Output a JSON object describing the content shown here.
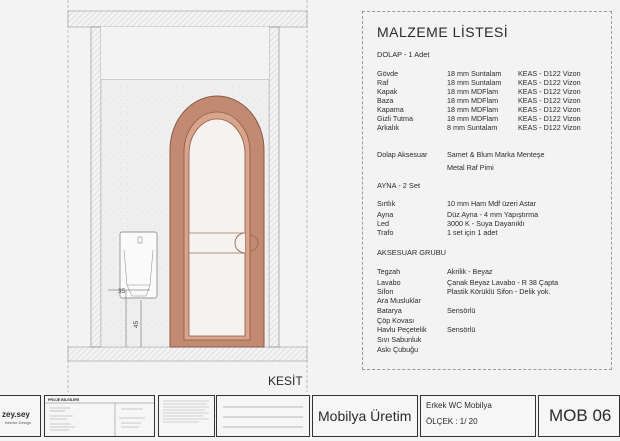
{
  "material_list": {
    "title": "MALZEME LİSTESİ",
    "sections": [
      {
        "heading": "DOLAP - 1 Adet",
        "rows": [
          {
            "label": "Gövde",
            "spec": "18 mm Suntalam",
            "code": "KEAS - D122 Vizon"
          },
          {
            "label": "Raf",
            "spec": "18 mm Suntalam",
            "code": "KEAS - D122 Vizon"
          },
          {
            "label": "Kapak",
            "spec": "18  mm  MDFlam",
            "code": "KEAS - D122 Vizon"
          },
          {
            "label": "Baza",
            "spec": "18  mm  MDFlam",
            "code": "KEAS - D122 Vizon"
          },
          {
            "label": "Kapama",
            "spec": "18  mm  MDFlam",
            "code": "KEAS - D122 Vizon"
          },
          {
            "label": "Gizli Tutma",
            "spec": "18  mm  MDFlam",
            "code": "KEAS - D122 Vizon"
          },
          {
            "label": "Arkalık",
            "spec": "8 mm Suntalam",
            "code": "KEAS - D122 Vizon"
          }
        ]
      },
      {
        "heading": "Dolap Aksesuar",
        "rows": [
          {
            "label": "",
            "spec": "Samet & Blum Marka Menteşe",
            "code": ""
          },
          {
            "label": "",
            "spec": "Metal Raf Pimi",
            "code": ""
          }
        ]
      },
      {
        "heading": "AYNA - 2 Set",
        "rows": [
          {
            "label": "Sırtlık",
            "spec": "10 mm Ham Mdf üzeri Astar",
            "code": ""
          },
          {
            "label": "Ayna",
            "spec": "Düz Ayna - 4 mm Yapıştırma",
            "code": ""
          },
          {
            "label": "Led",
            "spec": "3000 K - Suya Dayanıklı",
            "code": ""
          },
          {
            "label": "Trafo",
            "spec": "1 set için 1 adet",
            "code": ""
          }
        ]
      },
      {
        "heading": "AKSESUAR GRUBU",
        "rows": [
          {
            "label": "Tegzah",
            "spec": "Akrilik - Beyaz",
            "code": ""
          },
          {
            "label": "Lavabo",
            "spec": "Çanak Beyaz Lavabo - R 38 Çapta",
            "code": ""
          },
          {
            "label": "Sifon",
            "spec": "Plastik Körüklü Sifon - Delik yok.",
            "code": ""
          },
          {
            "label": "Ara Musluklar",
            "spec": "",
            "code": ""
          },
          {
            "label": "Batarya",
            "spec": "Sensörlü",
            "code": ""
          },
          {
            "label": "Çöp Kovası",
            "spec": "",
            "code": ""
          },
          {
            "label": "Havlu Peçetelik",
            "spec": "Sensörlü",
            "code": ""
          },
          {
            "label": "Sıvı Sabunluk",
            "spec": "",
            "code": ""
          },
          {
            "label": "Askı Çubuğu",
            "spec": "",
            "code": ""
          }
        ]
      }
    ]
  },
  "drawing": {
    "view_label": "KESİT",
    "dimensions": [
      "35",
      "45"
    ]
  },
  "title_block": {
    "logo": "zey.sey",
    "logo_sub": "Interior Design",
    "project_header": "PROJE BİLGİLERİ",
    "discipline": "Mobilya Üretim",
    "project_name": "Erkek WC Mobilya",
    "scale": "ÖLÇEK : 1/ 20",
    "sheet_code": "MOB 06"
  },
  "colors": {
    "door": "#c28a73",
    "door_edge": "#8a5a45",
    "wall_fill": "#e6e6e6",
    "hatch": "#c9c9c9"
  }
}
